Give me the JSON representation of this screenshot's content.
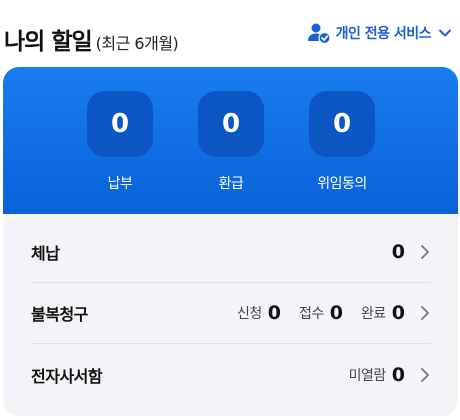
{
  "header": {
    "title": "나의 할일",
    "subtitle": "(최근 6개월)",
    "service_label": "개인 전용 서비스"
  },
  "stats": [
    {
      "label": "납부",
      "value": "0"
    },
    {
      "label": "환급",
      "value": "0"
    },
    {
      "label": "위임동의",
      "value": "0"
    }
  ],
  "rows": {
    "arrears": {
      "label": "체납",
      "value": "0"
    },
    "appeal": {
      "label": "불복청구",
      "items": [
        {
          "key": "신청",
          "value": "0"
        },
        {
          "key": "접수",
          "value": "0"
        },
        {
          "key": "완료",
          "value": "0"
        }
      ]
    },
    "mailbox": {
      "label": "전자사서함",
      "items": [
        {
          "key": "미열람",
          "value": "0"
        }
      ]
    }
  },
  "colors": {
    "accent": "#1a5fd6",
    "panel_blue": "#0a62d8",
    "stat_box": "#0b56c2",
    "panel_gray": "#f3f4f7"
  },
  "icons": [
    "user-check-icon",
    "chevron-down-icon",
    "chevron-right-icon"
  ]
}
